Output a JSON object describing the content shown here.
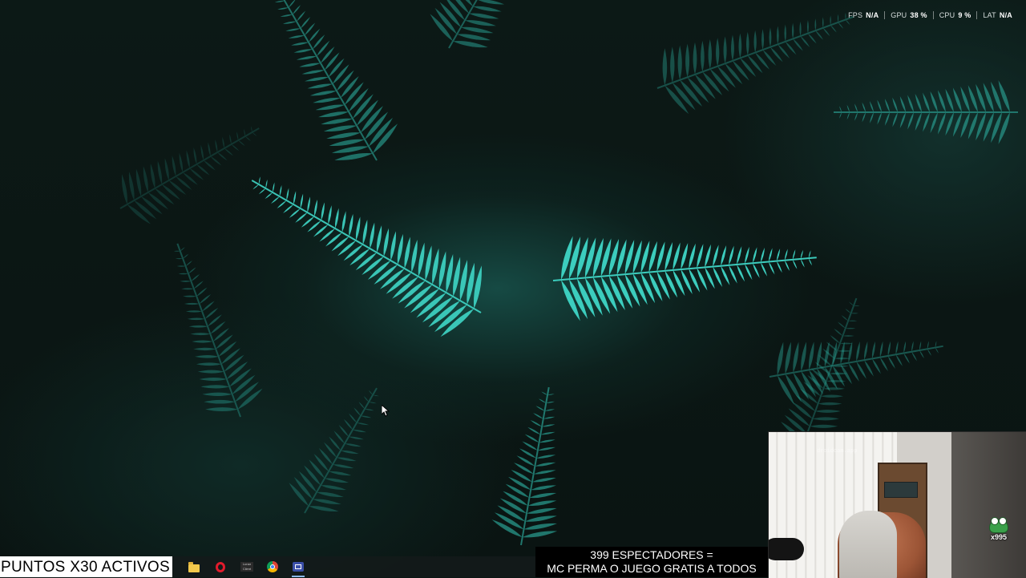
{
  "desktop": {
    "wallpaper": "fern-leaves",
    "colors": {
      "fern": "#2fb7a8",
      "fern_bright": "#3fd6c6",
      "background": "#0b1714"
    }
  },
  "perf_overlay": {
    "metrics": [
      {
        "label": "FPS",
        "value": "N/A"
      },
      {
        "label": "GPU",
        "value": "38 %"
      },
      {
        "label": "CPU",
        "value": "9 %"
      },
      {
        "label": "LAT",
        "value": "N/A"
      }
    ]
  },
  "stream_overlay": {
    "points_text": "PUNTOS X30 ACTIVOS",
    "caption_line1": "399 ESPECTADORES =",
    "caption_line2": "MC PERMA O JUEGO GRATIS A TODOS",
    "badge_count": "x995",
    "webcam_watermark": "droidcam.app"
  },
  "taskbar": {
    "apps": [
      {
        "name": "file-explorer-icon"
      },
      {
        "name": "opera-icon"
      },
      {
        "name": "launcher-icon",
        "label": "Lunar Client"
      },
      {
        "name": "chrome-icon"
      },
      {
        "name": "screenshot-tool-icon"
      }
    ]
  }
}
